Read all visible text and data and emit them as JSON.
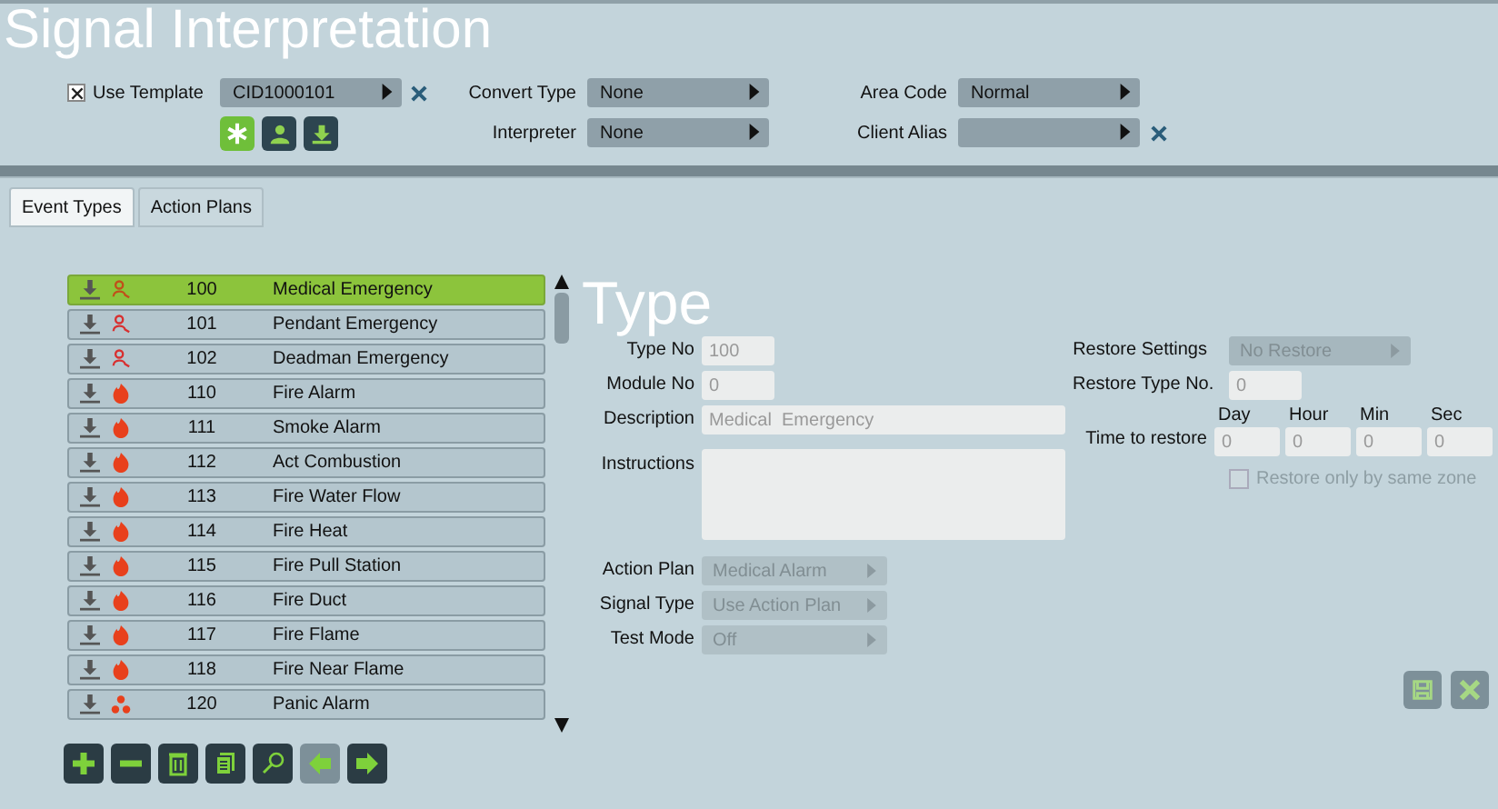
{
  "window": {
    "title": "Signal Interpretation"
  },
  "template": {
    "label": "Use Template",
    "checked": true,
    "value": "CID1000101"
  },
  "settings": [
    {
      "label": "Convert Type",
      "value": "None",
      "clearable": false
    },
    {
      "label": "Area Code",
      "value": "Normal",
      "clearable": false
    },
    {
      "label": "Interpreter",
      "value": "None",
      "clearable": false
    },
    {
      "label": "Client Alias",
      "clearable": true
    }
  ],
  "tabs": [
    {
      "label": "Event Types",
      "selected": true
    },
    {
      "label": "Action Plans",
      "selected": false
    }
  ],
  "events": [
    {
      "kind": "medical",
      "number": "100",
      "name": "Medical  Emergency",
      "selected": true
    },
    {
      "kind": "medical",
      "number": "101",
      "name": "Pendant Emergency",
      "selected": false
    },
    {
      "kind": "medical",
      "number": "102",
      "name": "Deadman Emergency",
      "selected": false
    },
    {
      "kind": "fire",
      "number": "110",
      "name": "Fire Alarm",
      "selected": false
    },
    {
      "kind": "fire",
      "number": "111",
      "name": "Smoke Alarm",
      "selected": false
    },
    {
      "kind": "fire",
      "number": "112",
      "name": "Act Combustion",
      "selected": false
    },
    {
      "kind": "fire",
      "number": "113",
      "name": "Fire Water Flow",
      "selected": false
    },
    {
      "kind": "fire",
      "number": "114",
      "name": "Fire Heat",
      "selected": false
    },
    {
      "kind": "fire",
      "number": "115",
      "name": "Fire Pull Station",
      "selected": false
    },
    {
      "kind": "fire",
      "number": "116",
      "name": "Fire Duct",
      "selected": false
    },
    {
      "kind": "fire",
      "number": "117",
      "name": "Fire Flame",
      "selected": false
    },
    {
      "kind": "fire",
      "number": "118",
      "name": "Fire Near Flame",
      "selected": false
    },
    {
      "kind": "panic",
      "number": "120",
      "name": "Panic Alarm",
      "selected": false
    }
  ],
  "toolbar": [
    {
      "kind": "add",
      "disabled": false
    },
    {
      "kind": "remove",
      "disabled": false
    },
    {
      "kind": "delete",
      "disabled": false
    },
    {
      "kind": "copy",
      "disabled": false
    },
    {
      "kind": "search",
      "disabled": false
    },
    {
      "kind": "back",
      "disabled": true
    },
    {
      "kind": "forward",
      "disabled": false
    }
  ],
  "detail": {
    "heading": "Type",
    "disabled": true,
    "type_no": {
      "label": "Type No",
      "value": "100"
    },
    "module_no": {
      "label": "Module No",
      "value": "0"
    },
    "description": {
      "label": "Description",
      "value": "Medical  Emergency"
    },
    "instructions": {
      "label": "Instructions"
    },
    "selects": [
      {
        "label": "Action Plan",
        "value": "Medical Alarm"
      },
      {
        "label": "Signal Type",
        "value": "Use Action Plan"
      },
      {
        "label": "Test Mode",
        "value": "Off"
      }
    ],
    "restore_settings": {
      "label": "Restore Settings",
      "value": "No Restore"
    },
    "restore_type_no": {
      "label": "Restore Type No.",
      "value": "0"
    },
    "time_to_restore": {
      "label": "Time to restore",
      "parts": [
        {
          "label": "Day",
          "value": "0"
        },
        {
          "label": "Hour",
          "value": "0"
        },
        {
          "label": "Min",
          "value": "0"
        },
        {
          "label": "Sec",
          "value": "0"
        }
      ]
    },
    "same_zone": {
      "label": "Restore only by same zone",
      "checked": false
    }
  }
}
